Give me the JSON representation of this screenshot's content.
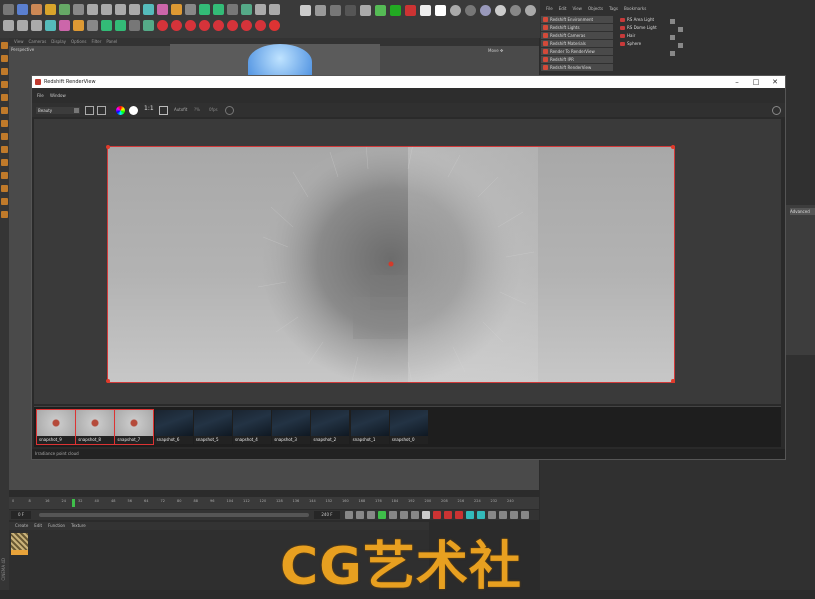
{
  "background_app": {
    "viewport_menu": [
      "View",
      "Cameras",
      "Display",
      "Options",
      "Filter",
      "Panel"
    ],
    "viewport_label": "Perspective",
    "viewport_right_label": "Move ✥",
    "object_manager_menu": [
      "File",
      "Edit",
      "View",
      "Objects",
      "Tags",
      "Bookmarks"
    ],
    "redshift_menu": [
      "Redshift Environment",
      "Redshift Lights",
      "Redshift Cameras",
      "Redshift Materials",
      "Render To RenderView",
      "Redshift IPR",
      "Redshift RenderView"
    ],
    "objects": [
      "RS Area Light",
      "RS Dome Light",
      "Hair",
      "Sphere"
    ],
    "timeline_ticks": [
      "0",
      "8",
      "16",
      "24",
      "32",
      "40",
      "48",
      "56",
      "64",
      "72",
      "80",
      "88",
      "96",
      "104",
      "112",
      "120",
      "128",
      "136",
      "144",
      "152",
      "160",
      "168",
      "176",
      "184",
      "192",
      "200",
      "208",
      "216",
      "224",
      "232",
      "240"
    ],
    "frame_start": "0 F",
    "frame_end": "240 F",
    "material_menu": [
      "Create",
      "Edit",
      "Function",
      "Texture"
    ],
    "side_label": "CINEMA 4D",
    "attr_tab": "Advanced",
    "watermark": "CG艺术社"
  },
  "renderview": {
    "title": "Redshift RenderView",
    "menu": [
      "File",
      "Window"
    ],
    "select_value": "Beauty",
    "ratio_label": "1:1",
    "autosize_label": "Autofit",
    "toolbar_extra": [
      "?%",
      "0fps"
    ],
    "snapshots": [
      {
        "label": "snapshot_9",
        "style": "light",
        "selected": true
      },
      {
        "label": "snapshot_8",
        "style": "light",
        "selected": true
      },
      {
        "label": "snapshot_7",
        "style": "light",
        "selected": true
      },
      {
        "label": "snapshot_6",
        "style": "dark",
        "selected": false
      },
      {
        "label": "snapshot_5",
        "style": "dark",
        "selected": false
      },
      {
        "label": "snapshot_4",
        "style": "dark",
        "selected": false
      },
      {
        "label": "snapshot_3",
        "style": "dark",
        "selected": false
      },
      {
        "label": "snapshot_2",
        "style": "dark",
        "selected": false
      },
      {
        "label": "snapshot_1",
        "style": "dark",
        "selected": false
      },
      {
        "label": "snapshot_0",
        "style": "dark",
        "selected": false
      }
    ],
    "status": "Irradiance point cloud"
  },
  "colors": {
    "accent": "#d13a3a",
    "timeline_marker": "#3fbf4a",
    "watermark": "#e8a020"
  }
}
